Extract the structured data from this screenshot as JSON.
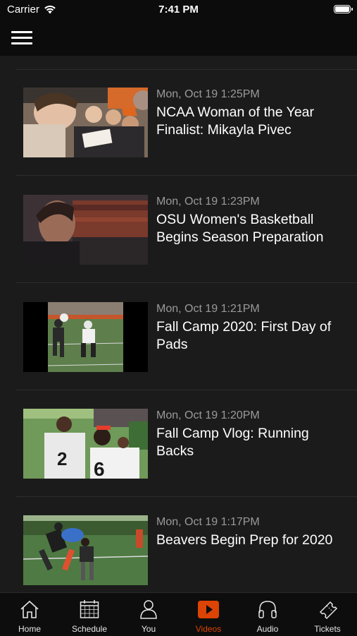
{
  "status_bar": {
    "carrier": "Carrier",
    "time": "7:41 PM"
  },
  "colors": {
    "accent": "#dc4405",
    "background": "#1b1b1b",
    "bar": "#0c0c0c"
  },
  "videos": [
    {
      "date": "Mon, Oct 19 1:25PM",
      "title": "NCAA Woman of the Year Finalist: Mikayla Pivec"
    },
    {
      "date": "Mon, Oct 19 1:23PM",
      "title": "OSU Women's Basketball Begins Season Preparation"
    },
    {
      "date": "Mon, Oct 19 1:21PM",
      "title": "Fall Camp 2020: First Day of Pads"
    },
    {
      "date": "Mon, Oct 19 1:20PM",
      "title": "Fall Camp Vlog: Running Backs"
    },
    {
      "date": "Mon, Oct 19 1:17PM",
      "title": "Beavers Begin Prep for 2020"
    }
  ],
  "tabs": [
    {
      "label": "Home",
      "icon": "home-icon"
    },
    {
      "label": "Schedule",
      "icon": "calendar-icon"
    },
    {
      "label": "You",
      "icon": "person-icon"
    },
    {
      "label": "Videos",
      "icon": "play-icon",
      "active": true
    },
    {
      "label": "Audio",
      "icon": "headphones-icon"
    },
    {
      "label": "Tickets",
      "icon": "ticket-icon"
    }
  ]
}
